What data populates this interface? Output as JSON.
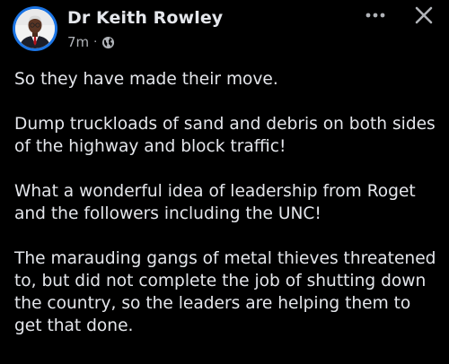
{
  "post": {
    "author": "Dr Keith Rowley",
    "time": "7m",
    "separator": "·",
    "visibility_icon": "globe-icon",
    "more_icon": "more-options-icon",
    "close_icon": "close-icon",
    "paragraphs": [
      "So they have made their move.",
      "Dump truckloads of sand and debris on both sides\nof the highway and block traffic!",
      "What a wonderful idea of leadership from Roget\nand the followers including the UNC!",
      "The marauding gangs of metal thieves threatened\nto, but did not complete the job of shutting down\nthe country, so the leaders are helping them to\nget that done."
    ]
  },
  "colors": {
    "background": "#000000",
    "text_primary": "#e4e6eb",
    "text_secondary": "#b0b3b8",
    "avatar_ring": "#1b74e4"
  }
}
